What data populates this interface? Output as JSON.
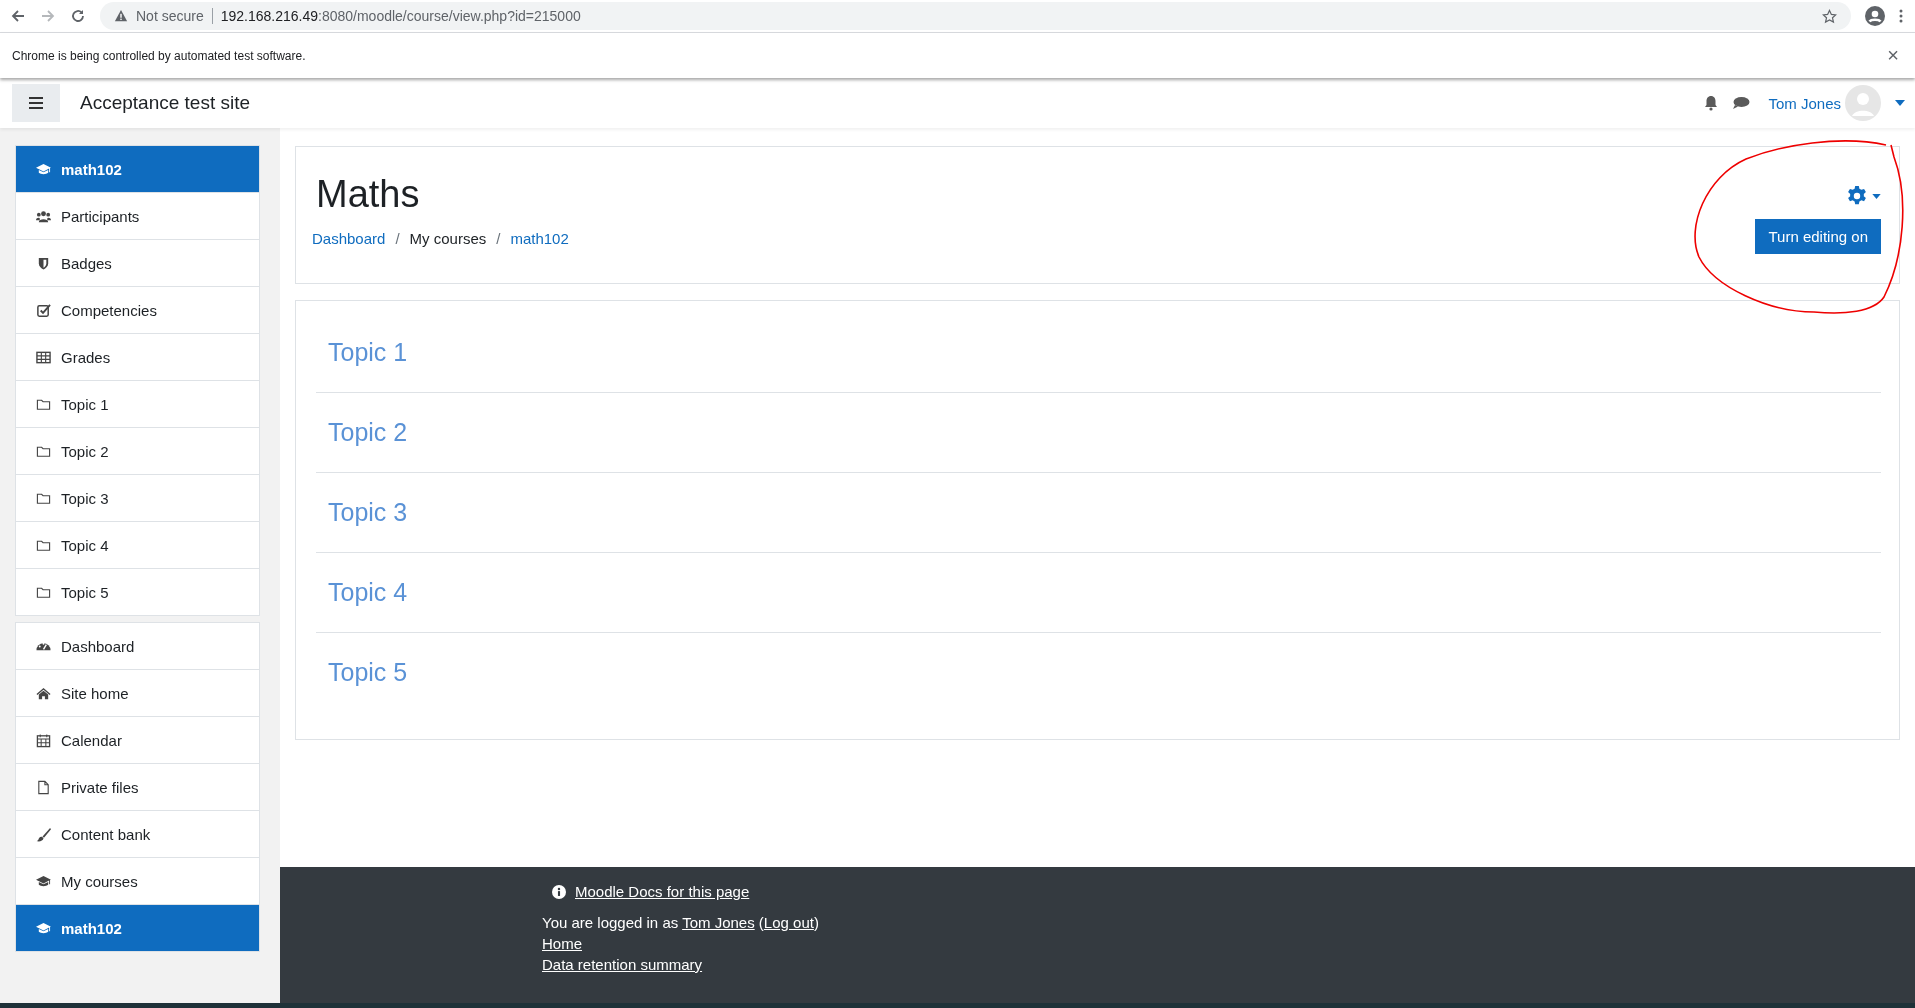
{
  "browser": {
    "security": "Not secure",
    "url_host": "192.168.216.49",
    "url_rest": ":8080/moodle/course/view.php?id=215000"
  },
  "infobar": {
    "message": "Chrome is being controlled by automated test software.",
    "close": "×"
  },
  "navbar": {
    "site_name": "Acceptance test site",
    "user_name": "Tom Jones"
  },
  "sidebar": {
    "groups": [
      [
        {
          "label": "math102",
          "selected": true
        },
        {
          "label": "Participants",
          "selected": false
        },
        {
          "label": "Badges",
          "selected": false
        },
        {
          "label": "Competencies",
          "selected": false
        },
        {
          "label": "Grades",
          "selected": false
        },
        {
          "label": "Topic 1",
          "selected": false
        },
        {
          "label": "Topic 2",
          "selected": false
        },
        {
          "label": "Topic 3",
          "selected": false
        },
        {
          "label": "Topic 4",
          "selected": false
        },
        {
          "label": "Topic 5",
          "selected": false
        }
      ],
      [
        {
          "label": "Dashboard",
          "selected": false
        },
        {
          "label": "Site home",
          "selected": false
        },
        {
          "label": "Calendar",
          "selected": false
        },
        {
          "label": "Private files",
          "selected": false
        },
        {
          "label": "Content bank",
          "selected": false
        },
        {
          "label": "My courses",
          "selected": false
        },
        {
          "label": "math102",
          "selected": true
        }
      ]
    ]
  },
  "header": {
    "title": "Maths",
    "breadcrumb": [
      {
        "label": "Dashboard",
        "kind": "link"
      },
      {
        "label": "/",
        "kind": "separator"
      },
      {
        "label": "My courses",
        "kind": "text"
      },
      {
        "label": "/",
        "kind": "separator"
      },
      {
        "label": "math102",
        "kind": "link"
      }
    ],
    "edit_button": "Turn editing on"
  },
  "topics": [
    "Topic 1",
    "Topic 2",
    "Topic 3",
    "Topic 4",
    "Topic 5"
  ],
  "footer": {
    "docs_link": "Moodle Docs for this page",
    "login_prefix": "You are logged in as",
    "login_user": "Tom Jones",
    "login_open": "(",
    "logout": "Log out",
    "login_close": ")",
    "links": [
      "Home",
      "Data retention summary"
    ]
  }
}
